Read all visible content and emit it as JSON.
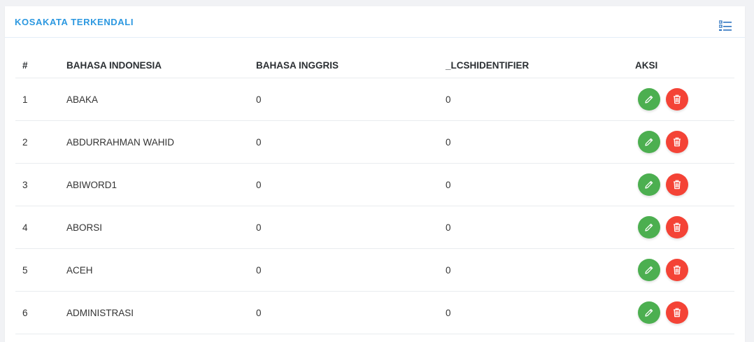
{
  "card": {
    "title": "KOSAKATA TERKENDALI",
    "header_icon": "list-icon"
  },
  "table": {
    "headers": {
      "num": "#",
      "indonesian": "BAHASA INDONESIA",
      "english": "BAHASA INGGRIS",
      "lcsidentifier": "_LCSHIDENTIFIER",
      "actions": "AKSI"
    },
    "rows": [
      {
        "num": "1",
        "indonesian": "ABAKA",
        "english": "0",
        "lcsidentifier": "0"
      },
      {
        "num": "2",
        "indonesian": "ABDURRAHMAN WAHID",
        "english": "0",
        "lcsidentifier": "0"
      },
      {
        "num": "3",
        "indonesian": "ABIWORD1",
        "english": "0",
        "lcsidentifier": "0"
      },
      {
        "num": "4",
        "indonesian": "ABORSI",
        "english": "0",
        "lcsidentifier": "0"
      },
      {
        "num": "5",
        "indonesian": "ACEH",
        "english": "0",
        "lcsidentifier": "0"
      },
      {
        "num": "6",
        "indonesian": "ADMINISTRASI",
        "english": "0",
        "lcsidentifier": "0"
      }
    ],
    "action_icons": {
      "edit": "pencil-icon",
      "delete": "trash-icon"
    }
  },
  "colors": {
    "title": "#2c98e0",
    "edit_button": "#4caf50",
    "delete_button": "#f44336"
  }
}
